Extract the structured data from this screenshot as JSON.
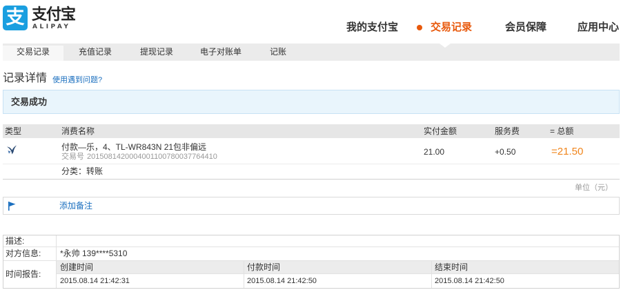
{
  "logo": {
    "mark": "支",
    "cn": "支付宝",
    "en": "ALIPAY"
  },
  "top_nav": [
    {
      "label": "我的支付宝",
      "active": false
    },
    {
      "label": "交易记录",
      "active": true
    },
    {
      "label": "会员保障",
      "active": false
    },
    {
      "label": "应用中心",
      "active": false
    }
  ],
  "sub_nav": [
    {
      "label": "交易记录",
      "active": true
    },
    {
      "label": "充值记录",
      "active": false
    },
    {
      "label": "提现记录",
      "active": false
    },
    {
      "label": "电子对账单",
      "active": false
    },
    {
      "label": "记账",
      "active": false
    }
  ],
  "page": {
    "title": "记录详情",
    "help_link": "使用遇到问题?"
  },
  "status": {
    "text": "交易成功"
  },
  "record_table": {
    "headers": {
      "type": "类型",
      "name": "消费名称",
      "paid": "实付金额",
      "fee": "服务费",
      "total": "= 总额"
    },
    "row": {
      "type_icon": "transfer-icon",
      "name": "付款—乐，4、TL-WR843N 21包非偏远",
      "trade_no_label": "交易号",
      "trade_no": "2015081420004001100780037764410",
      "paid": "21.00",
      "fee": "+0.50",
      "total": "=21.50"
    },
    "category": "分类：转账",
    "unit": "单位（元）"
  },
  "note": {
    "icon": "flag-icon",
    "link": "添加备注"
  },
  "details": {
    "description": {
      "label": "描述:",
      "value": ""
    },
    "counterparty": {
      "label": "对方信息:",
      "value": "*永帅 139****5310"
    },
    "time_report": {
      "label": "时间报告:",
      "columns": [
        {
          "label": "创建时间",
          "value": "2015.08.14 21:42:31"
        },
        {
          "label": "付款时间",
          "value": "2015.08.14 21:42:50"
        },
        {
          "label": "结束时间",
          "value": "2015.08.14 21:42:50"
        }
      ]
    }
  },
  "colors": {
    "brand_blue": "#1a9fe0",
    "accent_orange": "#e8590c",
    "total_orange": "#f0841a",
    "link_blue": "#1b6fbf",
    "status_bg": "#e9f5fc",
    "status_border": "#c7e2f4",
    "header_gray": "#e6e6e6"
  }
}
